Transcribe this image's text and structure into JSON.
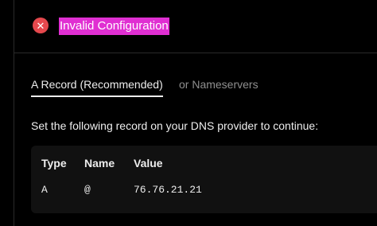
{
  "status": {
    "icon": "x-circle-icon",
    "title": "Invalid Configuration",
    "colors": {
      "error": "#e5484d",
      "highlight": "#e02fd2"
    }
  },
  "tabs": [
    {
      "label": "A Record (Recommended)",
      "active": true
    },
    {
      "label": "or Nameservers",
      "active": false
    }
  ],
  "instruction": "Set the following record on your DNS provider to continue:",
  "table": {
    "headers": [
      "Type",
      "Name",
      "Value"
    ],
    "rows": [
      {
        "type": "A",
        "name": "@",
        "value": "76.76.21.21"
      }
    ]
  }
}
